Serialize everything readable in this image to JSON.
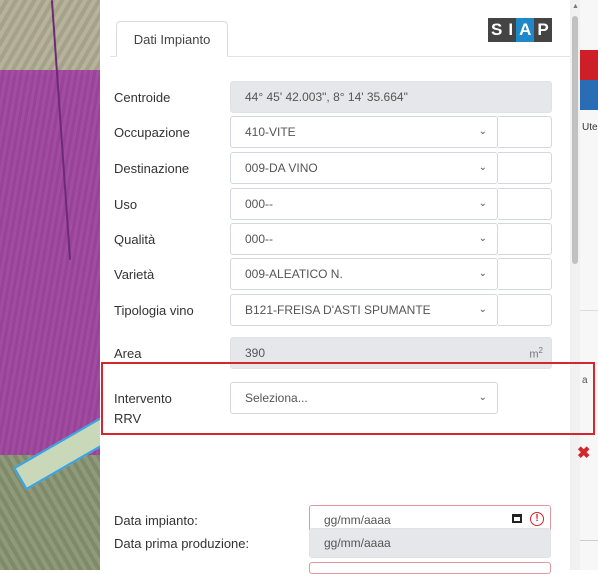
{
  "panel": {
    "tab_label": "Dati Impianto",
    "logo": {
      "s": "S",
      "i": "I",
      "a": "A",
      "p": "P"
    },
    "fields": [
      {
        "label": "Centroide",
        "value": "44° 45' 42.003\", 8° 14' 35.664\""
      },
      {
        "label": "Occupazione",
        "value": "410-VITE"
      },
      {
        "label": "Destinazione",
        "value": "009-DA VINO"
      },
      {
        "label": "Uso",
        "value": "000--"
      },
      {
        "label": "Qualità",
        "value": "000--"
      },
      {
        "label": "Varietà",
        "value": "009-ALEATICO N."
      },
      {
        "label": "Tipologia vino",
        "value": "B121-FREISA D'ASTI SPUMANTE"
      },
      {
        "label": "Area",
        "value": "390",
        "unit": "m",
        "unit_sup": "2"
      }
    ],
    "intervento": {
      "label_line1": "Intervento",
      "label_line2": "RRV",
      "placeholder": "Seleziona..."
    },
    "dates": [
      {
        "label": "Data impianto:",
        "placeholder": "gg/mm/aaaa"
      },
      {
        "label": "Data prima produzione:",
        "placeholder": "gg/mm/aaaa"
      }
    ]
  },
  "side_strip": {
    "text_top": "Ute",
    "text_mid": "a"
  },
  "colors": {
    "highlight": "#d3262f",
    "logo_blue": "#1e88c8",
    "map_purple": "#9a3f9a"
  },
  "icons": {
    "remove": "close-icon",
    "collapse": "double-chevron-up-icon",
    "calendar": "calendar-icon",
    "warning": "alert-circle-icon"
  }
}
